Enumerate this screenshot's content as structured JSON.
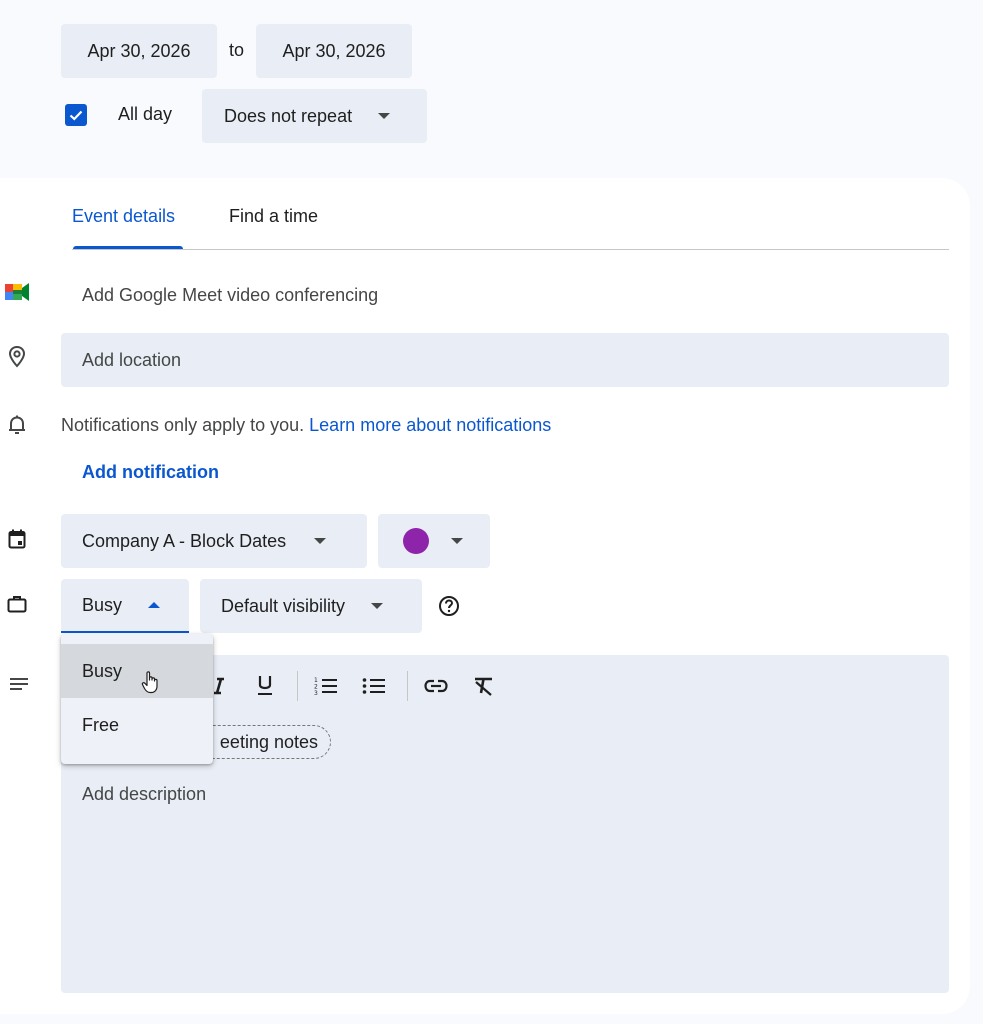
{
  "date_row": {
    "start_date": "Apr 30, 2026",
    "to_label": "to",
    "end_date": "Apr 30, 2026"
  },
  "allday_row": {
    "allday_checked": true,
    "allday_label": "All day",
    "repeat_value": "Does not repeat"
  },
  "tabs": [
    {
      "label": "Event details",
      "active": true
    },
    {
      "label": "Find a time",
      "active": false
    }
  ],
  "meet": {
    "label": "Add Google Meet video conferencing",
    "icon": "google-meet-icon"
  },
  "location": {
    "placeholder": "Add location",
    "icon": "location-pin-icon"
  },
  "notifications": {
    "icon": "bell-icon",
    "info_text": "Notifications only apply to you.",
    "learn_more_link": "Learn more about notifications",
    "add_notification": "Add notification"
  },
  "calendar": {
    "icon": "calendar-icon",
    "selected": "Company A - Block Dates",
    "color_hex": "#8e24aa"
  },
  "availability": {
    "icon": "briefcase-icon",
    "selected": "Busy",
    "visibility": "Default visibility",
    "help_icon": "help-circle-icon"
  },
  "availability_menu": {
    "items": [
      {
        "label": "Busy",
        "hovered": true
      },
      {
        "label": "Free",
        "hovered": false
      }
    ]
  },
  "description": {
    "icon": "notes-lines-icon",
    "meeting_notes_chip": "eeting notes",
    "placeholder": "Add description",
    "toolbar": [
      "italic-icon",
      "underline-icon",
      "numbered-list-icon",
      "bulleted-list-icon",
      "link-icon",
      "clear-formatting-icon"
    ]
  },
  "colors": {
    "accent": "#0b57d0",
    "field_bg": "#e9eef6",
    "page_bg": "#f8fafd"
  }
}
